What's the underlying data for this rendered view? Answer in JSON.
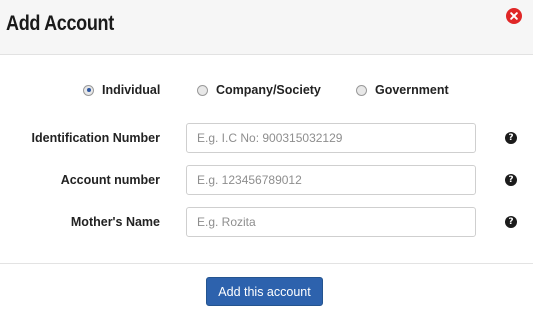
{
  "dialog": {
    "title": "Add Account",
    "close_icon": "close-icon",
    "close_color": "#e02727"
  },
  "account_type": {
    "options": [
      {
        "label": "Individual",
        "selected": true
      },
      {
        "label": "Company/Society",
        "selected": false
      },
      {
        "label": "Government",
        "selected": false
      }
    ]
  },
  "fields": [
    {
      "label": "Identification Number",
      "placeholder": "E.g. I.C No: 900315032129",
      "value": "",
      "help_icon": "question-circle-icon"
    },
    {
      "label": "Account number",
      "placeholder": "E.g. 123456789012",
      "value": "",
      "help_icon": "question-circle-icon"
    },
    {
      "label": "Mother's Name",
      "placeholder": "E.g. Rozita",
      "value": "",
      "help_icon": "question-circle-icon"
    }
  ],
  "actions": {
    "submit_label": "Add this account",
    "accent_color": "#2d62ad"
  }
}
